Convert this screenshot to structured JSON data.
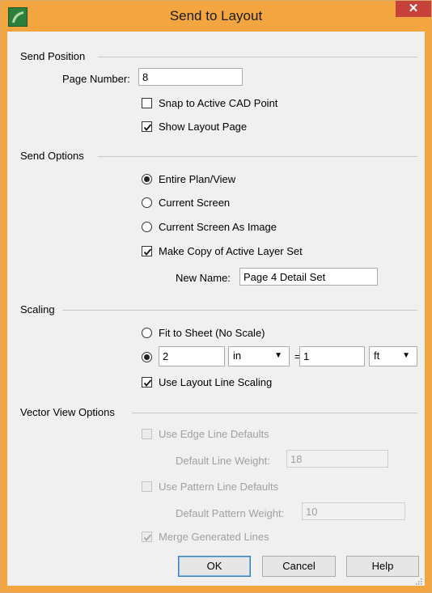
{
  "window": {
    "title": "Send to Layout",
    "close_glyph": "✕"
  },
  "send_position": {
    "heading": "Send Position",
    "page_number_label": "Page Number:",
    "page_number_value": "8",
    "snap_label": "Snap to Active CAD Point",
    "snap_checked": false,
    "show_layout_label": "Show Layout Page",
    "show_layout_checked": true
  },
  "send_options": {
    "heading": "Send Options",
    "entire_label": "Entire Plan/View",
    "current_screen_label": "Current Screen",
    "current_image_label": "Current Screen As Image",
    "selected": "Entire Plan/View",
    "make_copy_label": "Make Copy of Active Layer Set",
    "make_copy_checked": true,
    "new_name_label": "New Name:",
    "new_name_value": "Page 4 Detail Set"
  },
  "scaling": {
    "heading": "Scaling",
    "fit_label": "Fit to Sheet (No Scale)",
    "scale_left_value": "2",
    "scale_left_unit": "in",
    "equals": "=",
    "scale_right_value": "1",
    "scale_right_unit": "ft",
    "use_line_scaling_label": "Use Layout Line Scaling",
    "use_line_scaling_checked": true
  },
  "vector_view": {
    "heading": "Vector View Options",
    "edge_label": "Use Edge Line Defaults",
    "line_weight_label": "Default Line Weight:",
    "line_weight_value": "18",
    "pattern_label": "Use Pattern Line Defaults",
    "pattern_weight_label": "Default Pattern Weight:",
    "pattern_weight_value": "10",
    "merge_label": "Merge Generated Lines",
    "merge_checked": true
  },
  "buttons": {
    "ok": "OK",
    "cancel": "Cancel",
    "help": "Help"
  },
  "icons": {
    "dropdown": "chevron-down-icon",
    "app": "app-logo-icon"
  },
  "colors": {
    "titlebar": "#f3a640",
    "close": "#c6413a",
    "client": "#f0f0f0"
  }
}
